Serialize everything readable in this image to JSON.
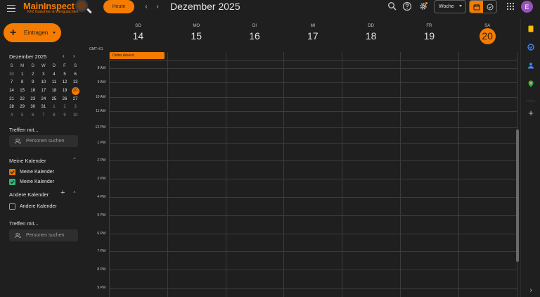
{
  "header": {
    "logo_title": "MainInspect",
    "logo_subtitle": "KFZ Gutachten & Wertgutachten",
    "today_label": "Heute",
    "prev_icon": "chevron-left-icon",
    "next_icon": "chevron-right-icon",
    "month_title": "Dezember 2025",
    "view_select": "Woche",
    "avatar_letter": "E",
    "accent_color": "#f57c00"
  },
  "sidebar": {
    "create_label": "Eintragen",
    "mini_calendar": {
      "title": "Dezember 2025",
      "weekday_headers": [
        "S",
        "M",
        "D",
        "W",
        "D",
        "F",
        "S"
      ],
      "weeks": [
        [
          "30",
          "1",
          "2",
          "3",
          "4",
          "5",
          "6"
        ],
        [
          "7",
          "8",
          "9",
          "10",
          "11",
          "12",
          "13"
        ],
        [
          "14",
          "15",
          "16",
          "17",
          "18",
          "19",
          "20"
        ],
        [
          "21",
          "22",
          "23",
          "24",
          "25",
          "26",
          "27"
        ],
        [
          "28",
          "29",
          "30",
          "31",
          "1",
          "2",
          "3"
        ],
        [
          "4",
          "5",
          "6",
          "7",
          "8",
          "9",
          "10"
        ]
      ],
      "today": "20"
    },
    "meet_title": "Treffen mit...",
    "search_people_placeholder": "Personen suchen",
    "my_calendars_title": "Meine Kalender",
    "my_calendars": [
      {
        "label": "Meine Kalender",
        "color": "#e37400"
      },
      {
        "label": "Meine Kalender",
        "color": "#33b679"
      }
    ],
    "other_calendars_title": "Andere Kalender",
    "other_calendars": [
      {
        "label": "Andere Kalender"
      }
    ],
    "meet_title_2": "Treffen mit...",
    "search_people_placeholder_2": "Personen suchen"
  },
  "week": {
    "timezone": "GMT+01",
    "days": [
      {
        "name": "SO",
        "num": "14"
      },
      {
        "name": "MO",
        "num": "15"
      },
      {
        "name": "DI",
        "num": "16"
      },
      {
        "name": "MI",
        "num": "17"
      },
      {
        "name": "DD",
        "num": "18"
      },
      {
        "name": "FR",
        "num": "19"
      },
      {
        "name": "SA",
        "num": "20"
      }
    ],
    "today_index": 6,
    "allday_event": "Dritter Advent",
    "hours": [
      "8 AM",
      "9 AM",
      "10 AM",
      "11 AM",
      "12 PM",
      "1 PM",
      "2 PM",
      "3 PM",
      "4 PM",
      "5 PM",
      "6 PM",
      "7 PM",
      "8 PM",
      "9 PM"
    ]
  }
}
